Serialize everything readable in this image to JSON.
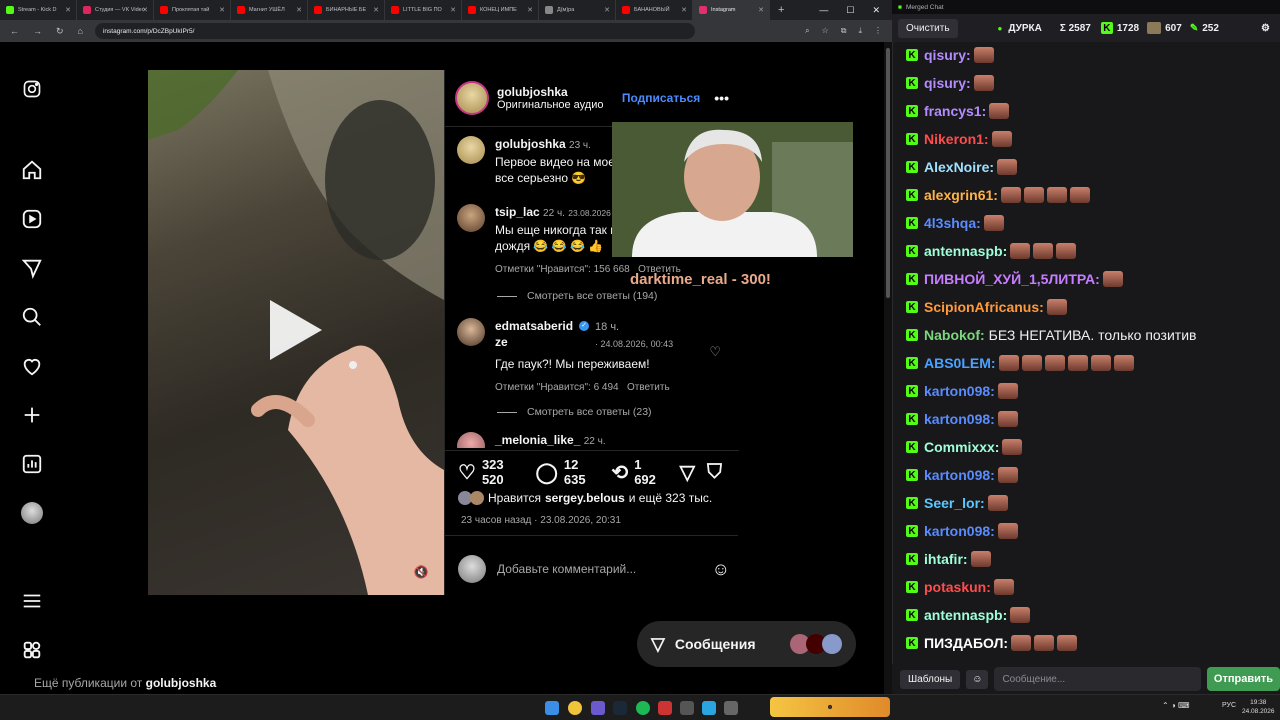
{
  "browser": {
    "tabs": [
      {
        "label": "Stream - Kick D",
        "favicon_color": "#53fc18"
      },
      {
        "label": "Студия — VK Video",
        "favicon_color": "#e0245e"
      },
      {
        "label": "Проклятая тай",
        "favicon_color": "#ff0000"
      },
      {
        "label": "Магнит УШЁЛ",
        "favicon_color": "#ff0000"
      },
      {
        "label": "БИНАРНЫЕ БЕ",
        "favicon_color": "#ff0000"
      },
      {
        "label": "LITTLE BIG ПО",
        "favicon_color": "#ff0000"
      },
      {
        "label": "КОНЕЦ ИМПЕ",
        "favicon_color": "#ff0000"
      },
      {
        "label": "Д(м)ра",
        "favicon_color": "#888888"
      },
      {
        "label": "БАНАНОВЫЙ",
        "favicon_color": "#ff0000"
      },
      {
        "label": "Instagram",
        "favicon_color": "#e1306c"
      }
    ],
    "url": "instagram.com/p/DcZBpUkIPr5/"
  },
  "post": {
    "author": "golubjoshka",
    "audio": "Оригинальное аудио",
    "follow_label": "Подписаться",
    "caption_author": "golubjoshka",
    "caption_time": "23 ч.",
    "caption_text_1": "Первое видео на моем",
    "caption_text_2": "все серьезно 😎",
    "comments": [
      {
        "user": "tsip_lac",
        "time": "22 ч.",
        "date": "23.08.2026",
        "text_1": "Мы еще никогда так не",
        "text_2": "дождя 😂 😂 😂 👍",
        "likes": "Отметки \"Нравится\": 156 668",
        "reply": "Ответить",
        "view_replies": "Смотреть все ответы (194)"
      },
      {
        "user_1": "edmatsaberid",
        "user_2": "ze",
        "time": "18 ч.",
        "date": "· 24.08.2026, 00:43",
        "text": "Где паук?! Мы переживаем!",
        "likes": "Отметки \"Нравится\": 6 494",
        "reply": "Ответить",
        "view_replies": "Смотреть все ответы (23)"
      },
      {
        "user": "_melonia_like_",
        "time": "22 ч."
      }
    ],
    "like_count": "323 520",
    "comment_count": "12 635",
    "repost_count": "1 692",
    "liked_by_prefix": "Нравится",
    "liked_by_user": "sergey.belous",
    "liked_by_suffix": "и ещё 323 тыс.",
    "posted_ago": "23 часов назад",
    "posted_date": "· 23.08.2026, 20:31",
    "add_comment_placeholder": "Добавьте комментарий..."
  },
  "overlay": {
    "donation_text": "darktime_real - 300!"
  },
  "messages": {
    "label": "Сообщения"
  },
  "more_posts": {
    "prefix": "Ещё публикации от",
    "user": "golubjoshka"
  },
  "chat": {
    "window_title": "Merged Chat",
    "clear_label": "Очистить",
    "channel": "ДУРКА",
    "stats": {
      "total": "Σ 2587",
      "kick": "1728",
      "vk": "607",
      "other": "252"
    },
    "messages": [
      {
        "user": "qisury:",
        "color": "#b48cff",
        "text": "",
        "emotes": 1
      },
      {
        "user": "qisury:",
        "color": "#b48cff",
        "text": "",
        "emotes": 1
      },
      {
        "user": "francys1:",
        "color": "#b48cff",
        "text": "",
        "emotes": 1
      },
      {
        "user": "Nikeron1:",
        "color": "#ff4d4d",
        "text": "",
        "emotes": 1
      },
      {
        "user": "AlexNoire:",
        "color": "#a0e0ff",
        "text": "",
        "emotes": 1
      },
      {
        "user": "alexgrin61:",
        "color": "#ffb347",
        "text": "",
        "emotes": 4
      },
      {
        "user": "4l3shqa:",
        "color": "#5b8cff",
        "text": "",
        "emotes": 1
      },
      {
        "user": "antennaspb:",
        "color": "#a0ffd8",
        "text": "",
        "emotes": 3
      },
      {
        "user": "ПИВНОЙ_ХУЙ_1,5ЛИТРА:",
        "color": "#c77dff",
        "text": "",
        "emotes": 1
      },
      {
        "user": "ScipionAfricanus:",
        "color": "#ff9a3c",
        "text": "",
        "emotes": 1
      },
      {
        "user": "Nabokof:",
        "color": "#7cd67c",
        "text": "БЕЗ НЕГАТИВА. только позитив",
        "emotes": 0
      },
      {
        "user": "ABS0LEM:",
        "color": "#4aa3ff",
        "text": "",
        "emotes": 6
      },
      {
        "user": "karton098:",
        "color": "#5b8cff",
        "text": "",
        "emotes": 1
      },
      {
        "user": "karton098:",
        "color": "#5b8cff",
        "text": "",
        "emotes": 1
      },
      {
        "user": "Commixxx:",
        "color": "#a0ffd8",
        "text": "",
        "emotes": 1
      },
      {
        "user": "karton098:",
        "color": "#5b8cff",
        "text": "",
        "emotes": 1
      },
      {
        "user": "Seer_lor:",
        "color": "#5bc8ff",
        "text": "",
        "emotes": 1
      },
      {
        "user": "karton098:",
        "color": "#5b8cff",
        "text": "",
        "emotes": 1
      },
      {
        "user": "ihtafir:",
        "color": "#a0ffd8",
        "text": "",
        "emotes": 1
      },
      {
        "user": "potaskun:",
        "color": "#ff4d4d",
        "text": "",
        "emotes": 1
      },
      {
        "user": "antennaspb:",
        "color": "#a0ffd8",
        "text": "",
        "emotes": 1
      },
      {
        "user": "ПИЗДАБОЛ:",
        "color": "#ffffff",
        "text": "",
        "emotes": 3
      }
    ],
    "templates_label": "Шаблоны",
    "input_placeholder": "Сообщение...",
    "send_label": "Отправить"
  },
  "taskbar": {
    "lang": "РУС",
    "time": "19:38",
    "date": "24.08.2026"
  }
}
